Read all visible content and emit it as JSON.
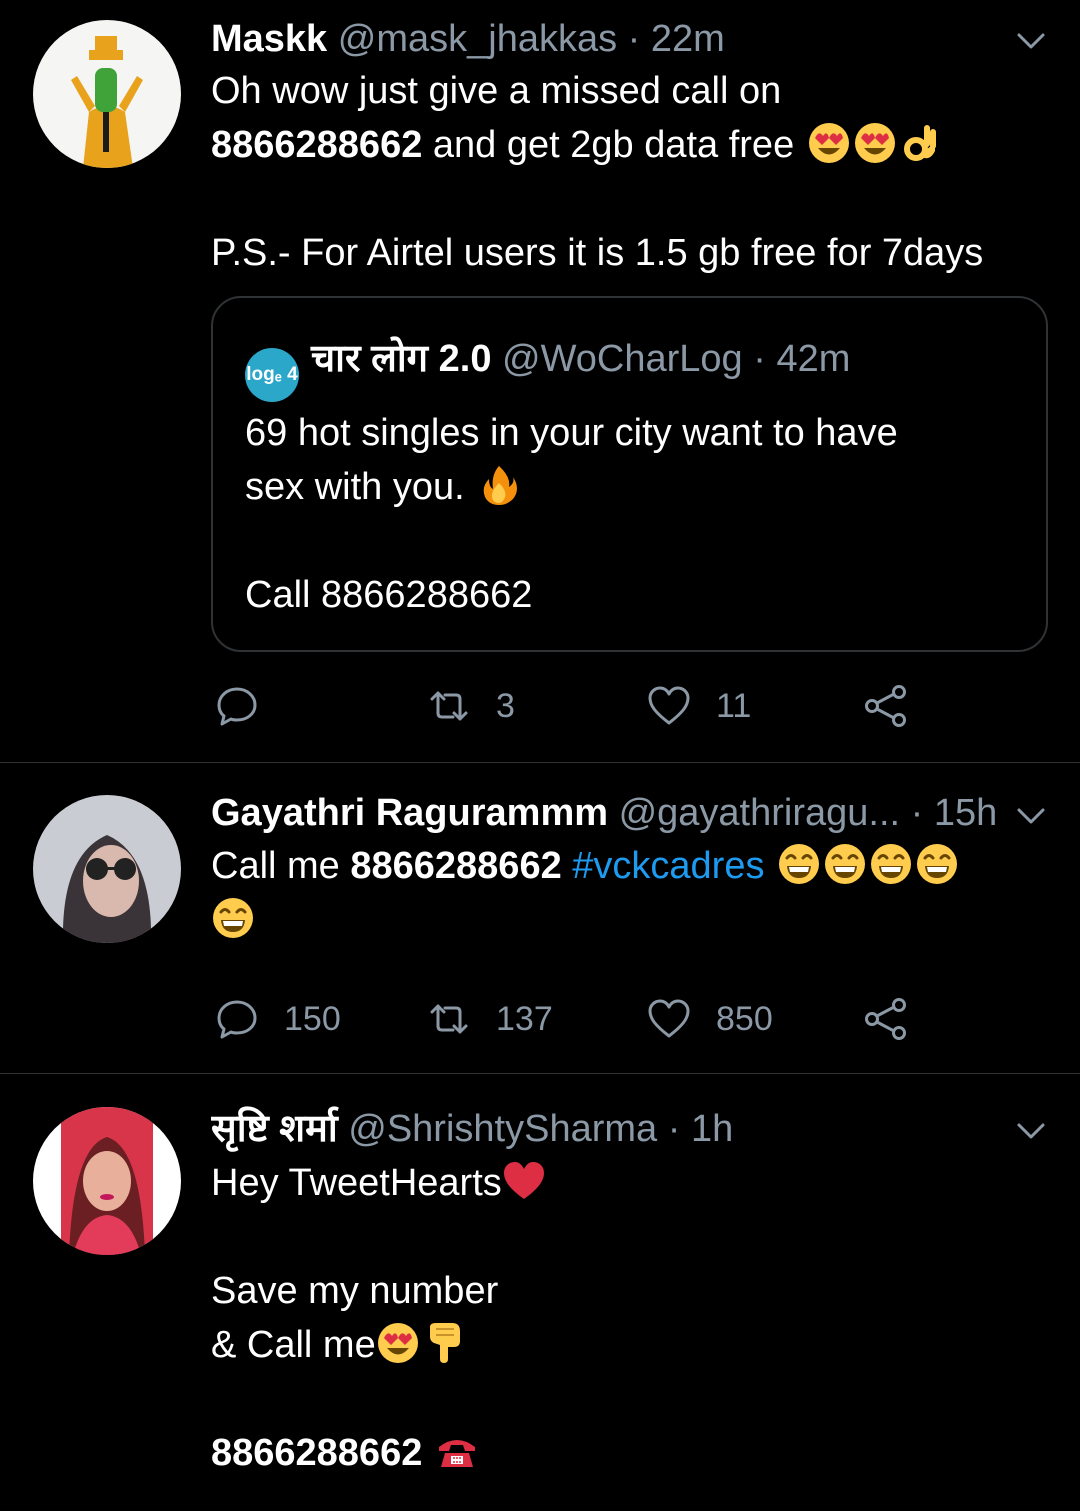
{
  "tweets": [
    {
      "name": "Maskk",
      "handle": "@mask_jhakkas",
      "separator": "·",
      "time": "22m",
      "line1": "Oh wow just give a missed call on",
      "line2_bold": "8866288662",
      "line2_text": " and get 2gb data free",
      "line3": "P.S.- For Airtel users it is 1.5 gb free for 7days",
      "emojis": [
        "heart-eyes-emoji",
        "heart-eyes-emoji",
        "ok-hand-emoji"
      ],
      "quote": {
        "logo_text": "logₑ 4",
        "name": "चार लोग 2.0",
        "handle": "@WoCharLog",
        "separator": "·",
        "time": "42m",
        "line1": "69 hot singles in your city want to have",
        "line2": "sex with you.",
        "line3": "Call 8866288662",
        "emoji": "fire-emoji"
      },
      "actions": {
        "reply": "",
        "retweet": "3",
        "like": "11"
      }
    },
    {
      "name": "Gayathri Ragurammm",
      "handle": "@gayathriragu...",
      "separator": "·",
      "time": "15h",
      "text_prefix": "Call me ",
      "text_bold": "8866288662",
      "text_space": " ",
      "hashtag": "#vckcadres",
      "emojis": [
        "grin-emoji",
        "grin-emoji",
        "grin-emoji",
        "grin-emoji",
        "grin-emoji"
      ],
      "actions": {
        "reply": "150",
        "retweet": "137",
        "like": "850"
      }
    },
    {
      "name": "सृष्टि शर्मा",
      "handle": "@ShrishtySharma",
      "separator": "·",
      "time": "1h",
      "line1": "Hey TweetHearts",
      "line2": "Save my number",
      "line3": "& Call me",
      "line4_bold": "8866288662",
      "emojis": [
        "red-heart-emoji",
        "heart-eyes-emoji",
        "pointing-down-emoji",
        "telephone-emoji"
      ]
    }
  ],
  "colors": {
    "background": "#000000",
    "primary_text": "#ffffff",
    "secondary_text": "#8b98a5",
    "link": "#1d9bf0",
    "divider": "#2f3336"
  }
}
